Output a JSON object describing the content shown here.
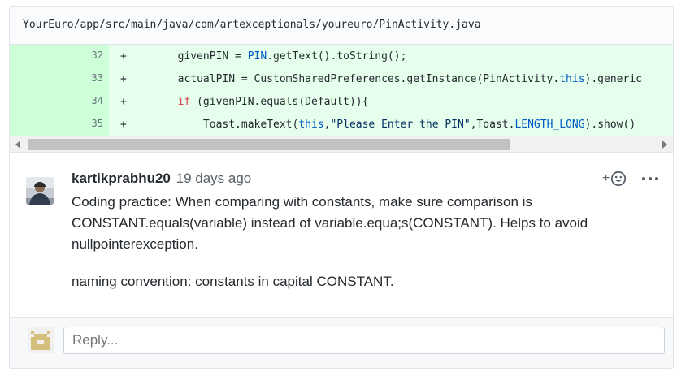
{
  "file": {
    "path": "YourEuro/app/src/main/java/com/artexceptionals/youreuro/PinActivity.java"
  },
  "diff": {
    "lines": [
      {
        "number": "32",
        "marker": "+",
        "tokens": [
          {
            "t": "        givenPIN = ",
            "c": "plain"
          },
          {
            "t": "PIN",
            "c": "const"
          },
          {
            "t": ".getText().toString();",
            "c": "plain"
          }
        ]
      },
      {
        "number": "33",
        "marker": "+",
        "tokens": [
          {
            "t": "        actualPIN = CustomSharedPreferences.getInstance(PinActivity.",
            "c": "plain"
          },
          {
            "t": "this",
            "c": "const"
          },
          {
            "t": ").generic",
            "c": "plain"
          }
        ]
      },
      {
        "number": "34",
        "marker": "+",
        "tokens": [
          {
            "t": "        ",
            "c": "plain"
          },
          {
            "t": "if",
            "c": "kw"
          },
          {
            "t": " (givenPIN.equals(Default)){",
            "c": "plain"
          }
        ]
      },
      {
        "number": "35",
        "marker": "+",
        "tokens": [
          {
            "t": "            Toast.makeText(",
            "c": "plain"
          },
          {
            "t": "this",
            "c": "const"
          },
          {
            "t": ",",
            "c": "plain"
          },
          {
            "t": "\"Please Enter the PIN\"",
            "c": "str"
          },
          {
            "t": ",Toast.",
            "c": "plain"
          },
          {
            "t": "LENGTH_LONG",
            "c": "const"
          },
          {
            "t": ").show()",
            "c": "plain"
          }
        ]
      }
    ]
  },
  "scroll": {
    "horizontal_position": 0.0,
    "visible_fraction": 0.77
  },
  "comment": {
    "author": "kartikprabhu20",
    "time": "19 days ago",
    "reaction_label": "+",
    "paragraphs": [
      "Coding practice: When comparing with constants, make sure comparison is CONSTANT.equals(variable) instead of variable.equa;s(CONSTANT). Helps to avoid nullpointerexception.",
      "naming convention: constants in capital CONSTANT."
    ]
  },
  "reply": {
    "placeholder": "Reply..."
  },
  "colors": {
    "added_line_bg": "#e6ffed",
    "added_gutter_bg": "#cdffd8",
    "keyword": "#d73a49",
    "constant": "#005cc5",
    "string": "#032f62"
  },
  "icons": {
    "reaction": "smiley-add-icon",
    "menu": "kebab-horizontal-icon",
    "scroll_left": "triangle-left-icon",
    "scroll_right": "triangle-right-icon"
  }
}
